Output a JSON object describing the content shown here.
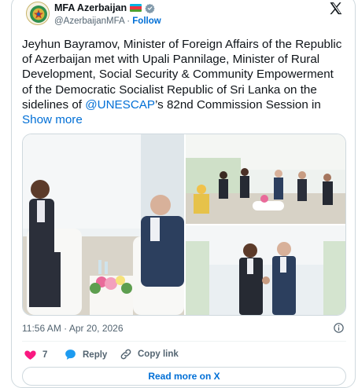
{
  "account": {
    "name": "MFA Azerbaijan",
    "handle": "@AzerbaijanMFA",
    "separator": "·",
    "follow_label": "Follow",
    "flag_icon": "azerbaijan-flag-icon",
    "verified_icon": "verified-badge-icon"
  },
  "tweet": {
    "text_before": "Jeyhun Bayramov, Minister of Foreign Affairs of the Republic of Azerbaijan met with Upali Pannilage, Minister of Rural Development, Social Security & Community Empowerment of the Democratic Socialist Republic of Sri Lanka on the sidelines of ",
    "mention": "@UNESCAP",
    "text_after": "’s 82nd Commission Session in ",
    "show_more": "Show more"
  },
  "media": {
    "photos": [
      {
        "alt": "Two ministers seated in conversation"
      },
      {
        "alt": "Delegations meeting around a table"
      },
      {
        "alt": "Ministers shaking hands"
      }
    ]
  },
  "meta": {
    "timestamp": "11:56 AM · Apr 20, 2026"
  },
  "actions": {
    "like_count": "7",
    "reply_label": "Reply",
    "copy_label": "Copy link"
  },
  "read_more": "Read more on X",
  "colors": {
    "accent": "#006fd6",
    "like": "#f91880",
    "secondary_text": "#536471",
    "border": "#cfd9de"
  }
}
